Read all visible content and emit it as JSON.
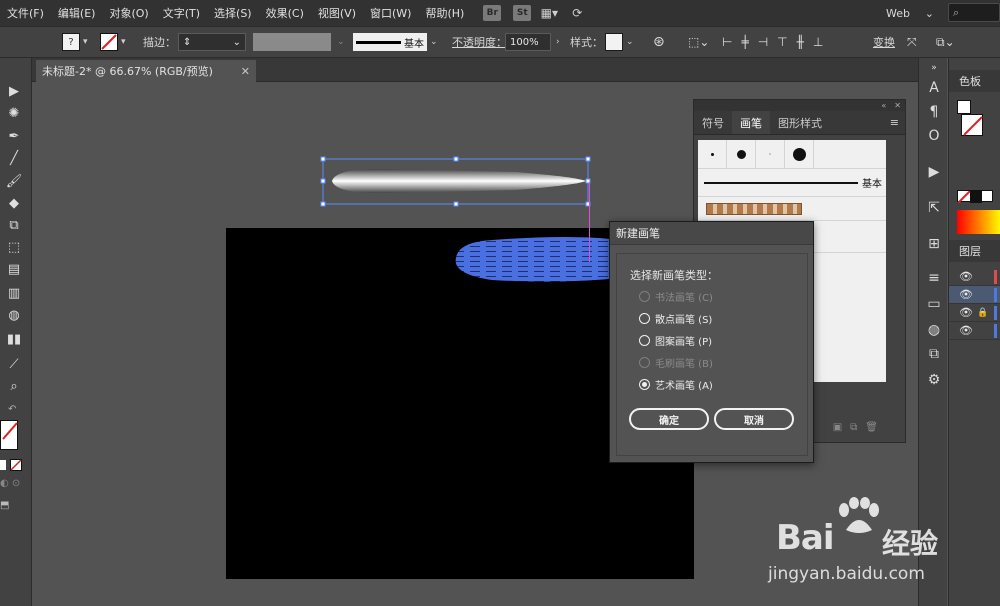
{
  "menubar": {
    "items": [
      "文件(F)",
      "编辑(E)",
      "对象(O)",
      "文字(T)",
      "选择(S)",
      "效果(C)",
      "视图(V)",
      "窗口(W)",
      "帮助(H)"
    ],
    "bridge_label": "Br",
    "stock_label": "St",
    "workspace": "Web",
    "search_icon": "search-icon"
  },
  "controlbar": {
    "stroke_label": "描边：",
    "stroke_profile": "基本",
    "opacity_label": "不透明度：",
    "opacity_value": "100%",
    "style_label": "样式：",
    "transform_label": "变换"
  },
  "document": {
    "tab_title": "未标题-2* @ 66.67% (RGB/预览)"
  },
  "brush_panel": {
    "tabs": [
      "符号",
      "画笔",
      "图形样式"
    ],
    "active_tab": "画笔",
    "basic_label": "基本"
  },
  "dialog": {
    "title": "新建画笔",
    "question": "选择新画笔类型：",
    "options": [
      {
        "label": "书法画笔 (C)",
        "enabled": false,
        "selected": false
      },
      {
        "label": "散点画笔 (S)",
        "enabled": true,
        "selected": false
      },
      {
        "label": "图案画笔 (P)",
        "enabled": true,
        "selected": false
      },
      {
        "label": "毛刷画笔 (B)",
        "enabled": false,
        "selected": false
      },
      {
        "label": "艺术画笔 (A)",
        "enabled": true,
        "selected": true
      }
    ],
    "ok_label": "确定",
    "cancel_label": "取消"
  },
  "right_panel": {
    "color_tab": "色板",
    "layers_tab": "图层"
  },
  "watermark": {
    "brand": "Bai",
    "brand_tail": "经验",
    "url": "jingyan.baidu.com"
  },
  "colors": {
    "selection": "#5a8cff",
    "blue_shape": "#4a6fe0",
    "guide": "#d84fd8",
    "layer_red": "#e04b4b",
    "layer_blue": "#4b7be0"
  }
}
